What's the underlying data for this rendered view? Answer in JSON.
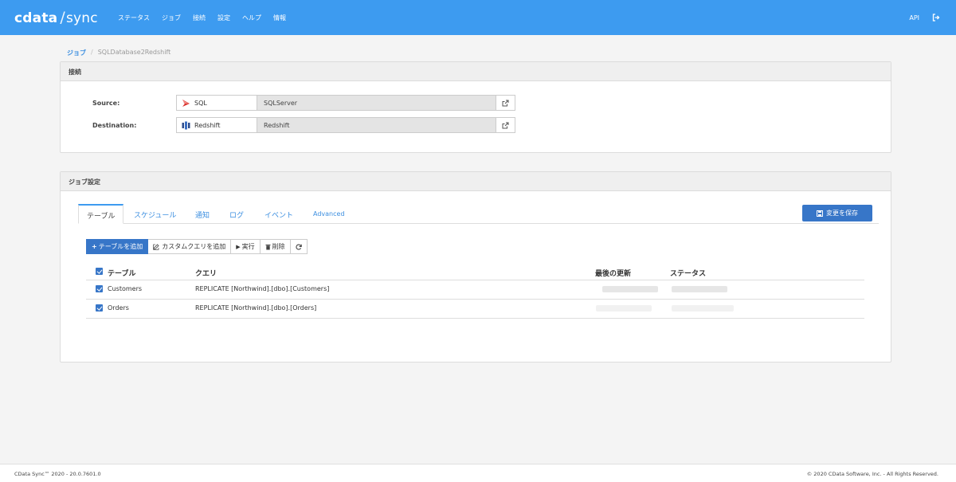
{
  "header": {
    "logo_bold": "cdata",
    "logo_light": "sync",
    "nav": [
      "ステータス",
      "ジョブ",
      "接続",
      "設定",
      "ヘルプ",
      "情報"
    ],
    "api_label": "API",
    "bg_color": "#3d9bf0"
  },
  "breadcrumb": {
    "jobs": "ジョブ",
    "separator": "/",
    "current": "SQLDatabase2Redshift"
  },
  "connection_panel": {
    "title": "接続",
    "source": {
      "label": "Source:",
      "driver": "SQL",
      "name": "SQLServer"
    },
    "destination": {
      "label": "Destination:",
      "driver": "Redshift",
      "name": "Redshift"
    }
  },
  "job_settings": {
    "title": "ジョブ設定",
    "tabs": [
      "テーブル",
      "スケジュール",
      "通知",
      "ログ",
      "イベント",
      "Advanced"
    ],
    "active_tab": "テーブル",
    "save_label": "変更を保存",
    "toolbar": {
      "add_table": "テーブルを追加",
      "add_custom_query": "カスタムクエリを追加",
      "run": "実行",
      "delete": "削除"
    },
    "table": {
      "columns": [
        "テーブル",
        "クエリ",
        "最後の更新",
        "ステータス"
      ],
      "rows": [
        {
          "name": "Customers",
          "query": "REPLICATE [Northwind].[dbo].[Customers]",
          "checked": true
        },
        {
          "name": "Orders",
          "query": "REPLICATE [Northwind].[dbo].[Orders]",
          "checked": true
        }
      ]
    }
  },
  "footer": {
    "version": "CData Sync™ 2020 - 20.0.7601.0",
    "copyright": "© 2020 CData Software, Inc. - All Rights Reserved."
  }
}
